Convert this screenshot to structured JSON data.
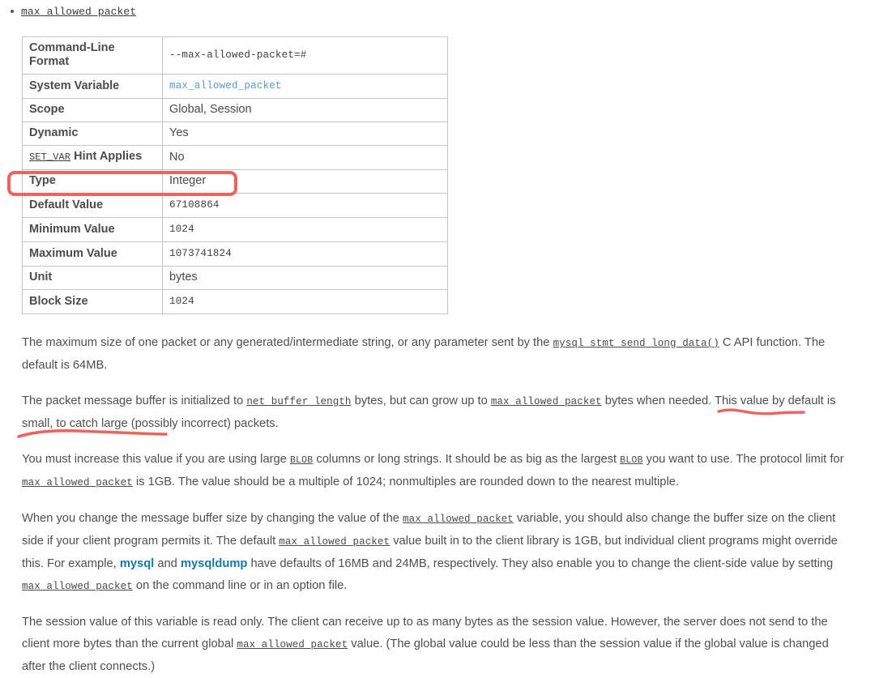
{
  "heading": {
    "variable_name": "max_allowed_packet"
  },
  "table": {
    "name": "max_allowed_packet-property-table",
    "rows": [
      {
        "label": "Command-Line Format",
        "value": "--max-allowed-packet=#",
        "value_style": "mono"
      },
      {
        "label": "System Variable",
        "value": "max_allowed_packet",
        "value_style": "mono-link"
      },
      {
        "label": "Scope",
        "value": "Global, Session",
        "value_style": "plain"
      },
      {
        "label": "Dynamic",
        "value": "Yes",
        "value_style": "plain"
      },
      {
        "label": "SET_VAR Hint Applies",
        "label_prefix_code": "SET_VAR",
        "label_rest": " Hint Applies",
        "value": "No",
        "value_style": "plain"
      },
      {
        "label": "Type",
        "value": "Integer",
        "value_style": "plain"
      },
      {
        "label": "Default Value",
        "value": "67108864",
        "value_style": "mono"
      },
      {
        "label": "Minimum Value",
        "value": "1024",
        "value_style": "mono"
      },
      {
        "label": "Maximum Value",
        "value": "1073741824",
        "value_style": "mono"
      },
      {
        "label": "Unit",
        "value": "bytes",
        "value_style": "plain"
      },
      {
        "label": "Block Size",
        "value": "1024",
        "value_style": "mono"
      }
    ]
  },
  "paragraphs": {
    "p1": {
      "part1": "The maximum size of one packet or any generated/intermediate string, or any parameter sent by the ",
      "code1": "mysql_stmt_send_long_data()",
      "part2": " C API function. The default is 64MB."
    },
    "p2": {
      "part1": "The packet message buffer is initialized to ",
      "code1": "net_buffer_length",
      "part2": " bytes, but can grow up to ",
      "code2": "max_allowed_packet",
      "part3": " bytes when needed. This value by default is small, to catch large (possibly incorrect) packets."
    },
    "p3": {
      "part1": "You must increase this value if you are using large ",
      "blob1": "BLOB",
      "part2": " columns or long strings. It should be as big as the largest ",
      "blob2": "BLOB",
      "part3": " you want to use. The protocol limit for ",
      "code1": "max_allowed_packet",
      "part4": " is 1GB. The value should be a multiple of 1024; nonmultiples are rounded down to the nearest multiple."
    },
    "p4": {
      "part1": "When you change the message buffer size by changing the value of the ",
      "code1": "max_allowed_packet",
      "part2": " variable, you should also change the buffer size on the client side if your client program permits it. The default ",
      "code2": "max_allowed_packet",
      "part3": " value built in to the client library is 1GB, but individual client programs might override this. For example, ",
      "link1": "mysql",
      "part4": " and ",
      "link2": "mysqldump",
      "part5": " have defaults of 16MB and 24MB, respectively. They also enable you to change the client-side value by setting ",
      "code3": "max_allowed_packet",
      "part6": " on the command line or in an option file."
    },
    "p5": {
      "part1": "The session value of this variable is read only. The client can receive up to as many bytes as the session value. However, the server does not send to the client more bytes than the current global ",
      "code1": "max_allowed_packet",
      "part2": " value. (The global value could be less than the session value if the global value is changed after the client connects.)"
    }
  },
  "annotations": {
    "color": "#f0625c",
    "box": {
      "name": "default-value-highlight-box",
      "target": "Default Value 67108864"
    },
    "underline_1": {
      "name": "protocol-limit-underline",
      "target": "The protocol limit for"
    },
    "underline_2": {
      "name": "max-allowed-packet-underline",
      "target": "max_allowed_packet"
    }
  }
}
